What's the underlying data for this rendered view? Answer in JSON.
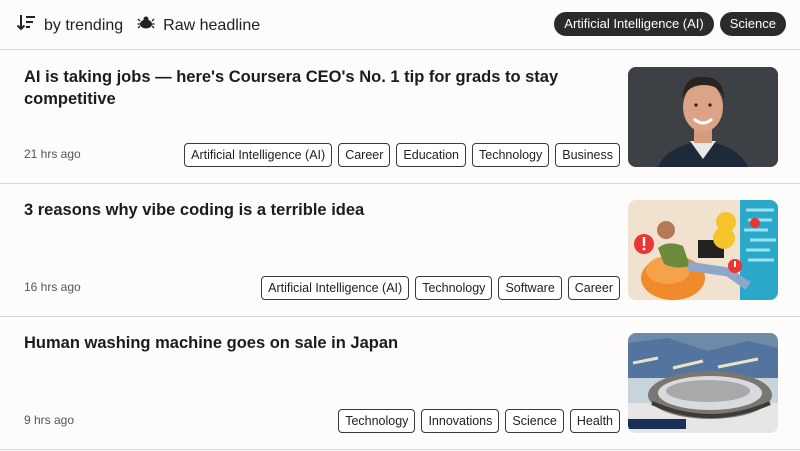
{
  "toolbar": {
    "sort_label": "by trending",
    "sort_icon": "sort-descending-icon",
    "mode_label": "Raw headline",
    "mode_icon": "bug-icon",
    "filters": [
      "Artificial Intelligence (AI)",
      "Science"
    ]
  },
  "articles": [
    {
      "title": "AI is taking jobs — here's Coursera CEO's No. 1 tip for grads to stay competitive",
      "time": "21 hrs ago",
      "tags": [
        "Artificial Intelligence (AI)",
        "Career",
        "Education",
        "Technology",
        "Business"
      ],
      "thumbnail": "portrait-photo"
    },
    {
      "title": "3 reasons why vibe coding is a terrible idea",
      "time": "16 hrs ago",
      "tags": [
        "Artificial Intelligence (AI)",
        "Technology",
        "Software",
        "Career"
      ],
      "thumbnail": "illustration-man-beanbag"
    },
    {
      "title": "Human washing machine goes on sale in Japan",
      "time": "9 hrs ago",
      "tags": [
        "Technology",
        "Innovations",
        "Science",
        "Health"
      ],
      "thumbnail": "photo-capsule-machine"
    }
  ]
}
